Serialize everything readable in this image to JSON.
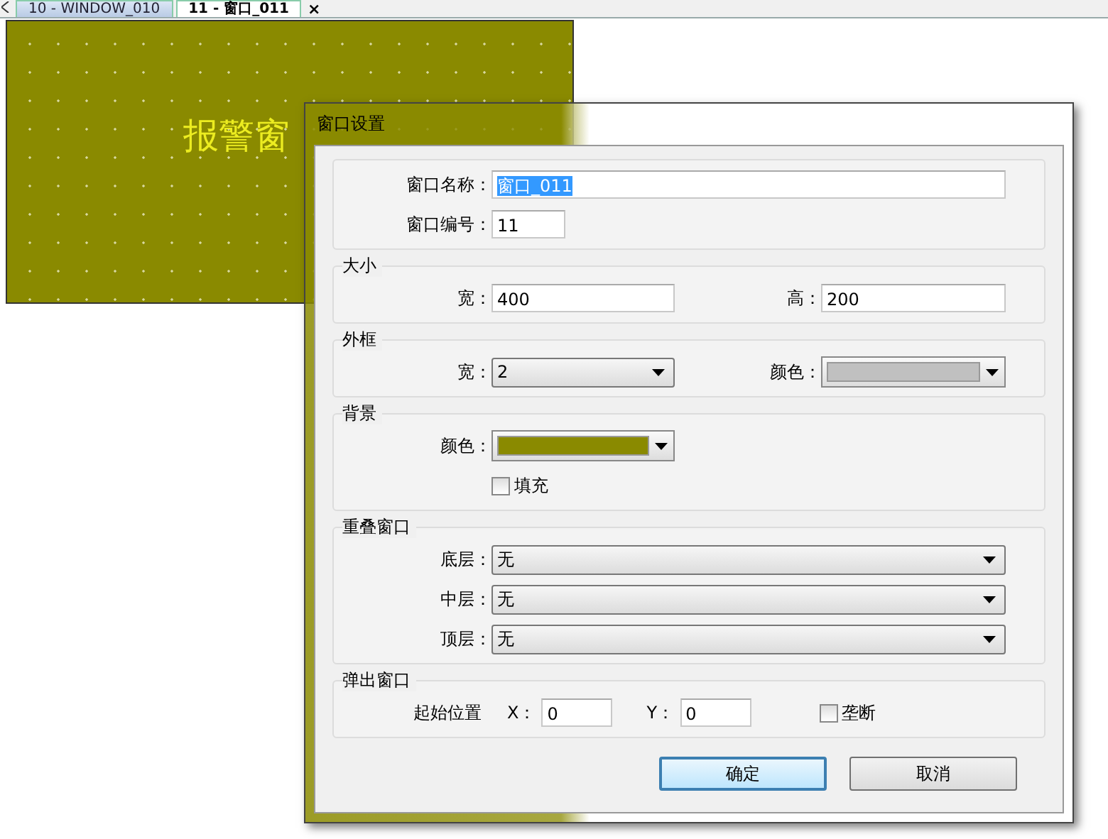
{
  "tabs": [
    {
      "label": "10 - WINDOW_010",
      "selected": false
    },
    {
      "label": "11 - 窗口_011",
      "selected": true,
      "close": "×"
    }
  ],
  "canvas": {
    "text": "报警窗"
  },
  "dialog": {
    "title": "窗口设置",
    "groups": [
      {
        "rows": [
          {
            "fields": [
              {
                "kind": "text",
                "label": "窗口名称：",
                "value": "窗口_011",
                "selected": true
              }
            ]
          },
          {
            "fields": [
              {
                "kind": "number",
                "label": "窗口编号：",
                "value": "11"
              }
            ]
          }
        ]
      },
      {
        "title": "大小",
        "rows": [
          {
            "fields": [
              {
                "kind": "number",
                "label": "宽：",
                "value": "400"
              },
              {
                "kind": "number",
                "label": "高：",
                "value": "200"
              }
            ]
          }
        ]
      },
      {
        "title": "外框",
        "rows": [
          {
            "fields": [
              {
                "kind": "dropdown",
                "label": "宽：",
                "value": "2"
              },
              {
                "kind": "color",
                "label": "颜色：",
                "color": "#c0c0c0"
              }
            ]
          }
        ]
      },
      {
        "title": "背景",
        "rows": [
          {
            "fields": [
              {
                "kind": "color",
                "label": "颜色：",
                "color": "#8a8a00"
              }
            ]
          },
          {
            "fields": [
              {
                "kind": "checkbox",
                "label": "填充",
                "checked": false
              }
            ]
          }
        ]
      },
      {
        "title": "重叠窗口",
        "rows": [
          {
            "fields": [
              {
                "kind": "dropdown",
                "label": "底层：",
                "value": "无"
              }
            ]
          },
          {
            "fields": [
              {
                "kind": "dropdown",
                "label": "中层：",
                "value": "无"
              }
            ]
          },
          {
            "fields": [
              {
                "kind": "dropdown",
                "label": "顶层：",
                "value": "无"
              }
            ]
          }
        ]
      },
      {
        "title": "弹出窗口",
        "rows": [
          {
            "fields": [
              {
                "kind": "caption",
                "label": "起始位置"
              },
              {
                "kind": "coord",
                "label": "X：",
                "value": "0"
              },
              {
                "kind": "coord",
                "label": "Y：",
                "value": "0"
              },
              {
                "kind": "checkbox",
                "label": "垄断",
                "checked": false
              }
            ]
          }
        ]
      }
    ],
    "buttons": [
      {
        "label": "确定",
        "default": true
      },
      {
        "label": "取消",
        "default": false
      }
    ]
  }
}
